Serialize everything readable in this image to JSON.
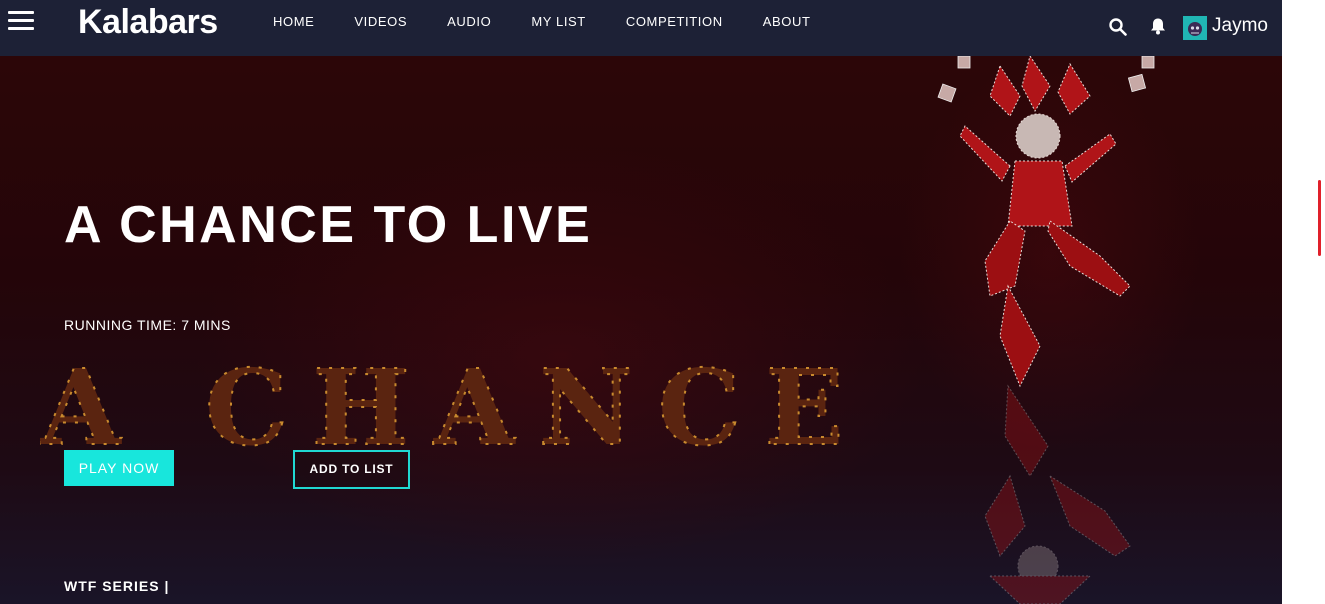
{
  "header": {
    "logo": "Kalabars",
    "nav": [
      "HOME",
      "VIDEOS",
      "AUDIO",
      "MY LIST",
      "COMPETITION",
      "ABOUT"
    ],
    "username": "Jaymo",
    "icons": [
      "menu-icon",
      "search-icon",
      "bell-icon",
      "avatar"
    ]
  },
  "hero": {
    "title": "A CHANCE TO LIVE",
    "running_time": "RUNNING TIME: 7 MINS",
    "background_word": "A CHANCE",
    "play_label": "PLAY NOW",
    "add_label": "ADD TO LIST"
  },
  "section": {
    "title": "WTF SERIES |"
  },
  "colors": {
    "accent": "#18e6dc",
    "header_bg": "#1d2136",
    "hero_bg": "#2c0608"
  }
}
